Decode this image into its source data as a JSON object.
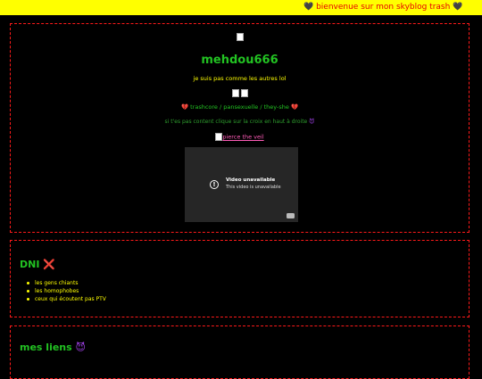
{
  "marquee": {
    "text": "🖤 bienvenue sur mon skyblog trash 🖤"
  },
  "profile": {
    "name": "mehdou666",
    "tagline": "je suis pas comme les autres lol",
    "tags_prefix": "💔",
    "tags": "trashcore / pansexuelle / they-she",
    "tags_suffix": "💔",
    "hint": "si t'es pas content clique sur la croix en haut à droite",
    "hint_emoji": "😈",
    "pierce_link": "pierce the veil",
    "video": {
      "title": "Video unavailable",
      "subtitle": "This video is unavailable"
    }
  },
  "dni": {
    "heading": "DNI",
    "heading_emoji": "❌",
    "items": [
      "les gens chiants",
      "les homophobes",
      "ceux qui écoutent pas PTV"
    ]
  },
  "links": {
    "heading": "mes liens",
    "heading_emoji": "😈"
  },
  "colors": {
    "background": "#000000",
    "marquee_bg": "#ffff00",
    "marquee_text": "#e60000",
    "border": "#ff1a1a",
    "green": "#22c222",
    "yellow": "#ffff00",
    "pink": "#ff5cb8"
  }
}
